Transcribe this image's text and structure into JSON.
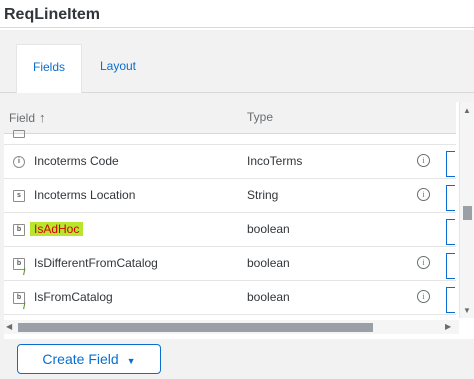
{
  "page": {
    "title": "ReqLineItem"
  },
  "tabs": [
    {
      "label": "Fields",
      "active": true
    },
    {
      "label": "Layout",
      "active": false
    }
  ],
  "table": {
    "columns": {
      "field": "Field",
      "type": "Type"
    },
    "rows": [
      {
        "icon": "readonly-field-icon",
        "glyph": "i",
        "name": "Incoterms Code",
        "type": "IncoTerms"
      },
      {
        "icon": "string-field-icon",
        "glyph": "s",
        "name": "Incoterms Location",
        "type": "String"
      },
      {
        "icon": "boolean-field-icon",
        "glyph": "b",
        "name": "IsAdHoc",
        "type": "boolean",
        "highlight": true
      },
      {
        "icon": "boolean-field-icon",
        "glyph": "b",
        "name": "IsDifferentFromCatalog",
        "type": "boolean"
      },
      {
        "icon": "boolean-field-icon",
        "glyph": "b",
        "name": "IsFromCatalog",
        "type": "boolean"
      }
    ]
  },
  "footer": {
    "create_label": "Create Field"
  },
  "colors": {
    "accent": "#0a6ed1",
    "highlight_bg": "#b8e62e",
    "highlight_text": "#d40000"
  }
}
